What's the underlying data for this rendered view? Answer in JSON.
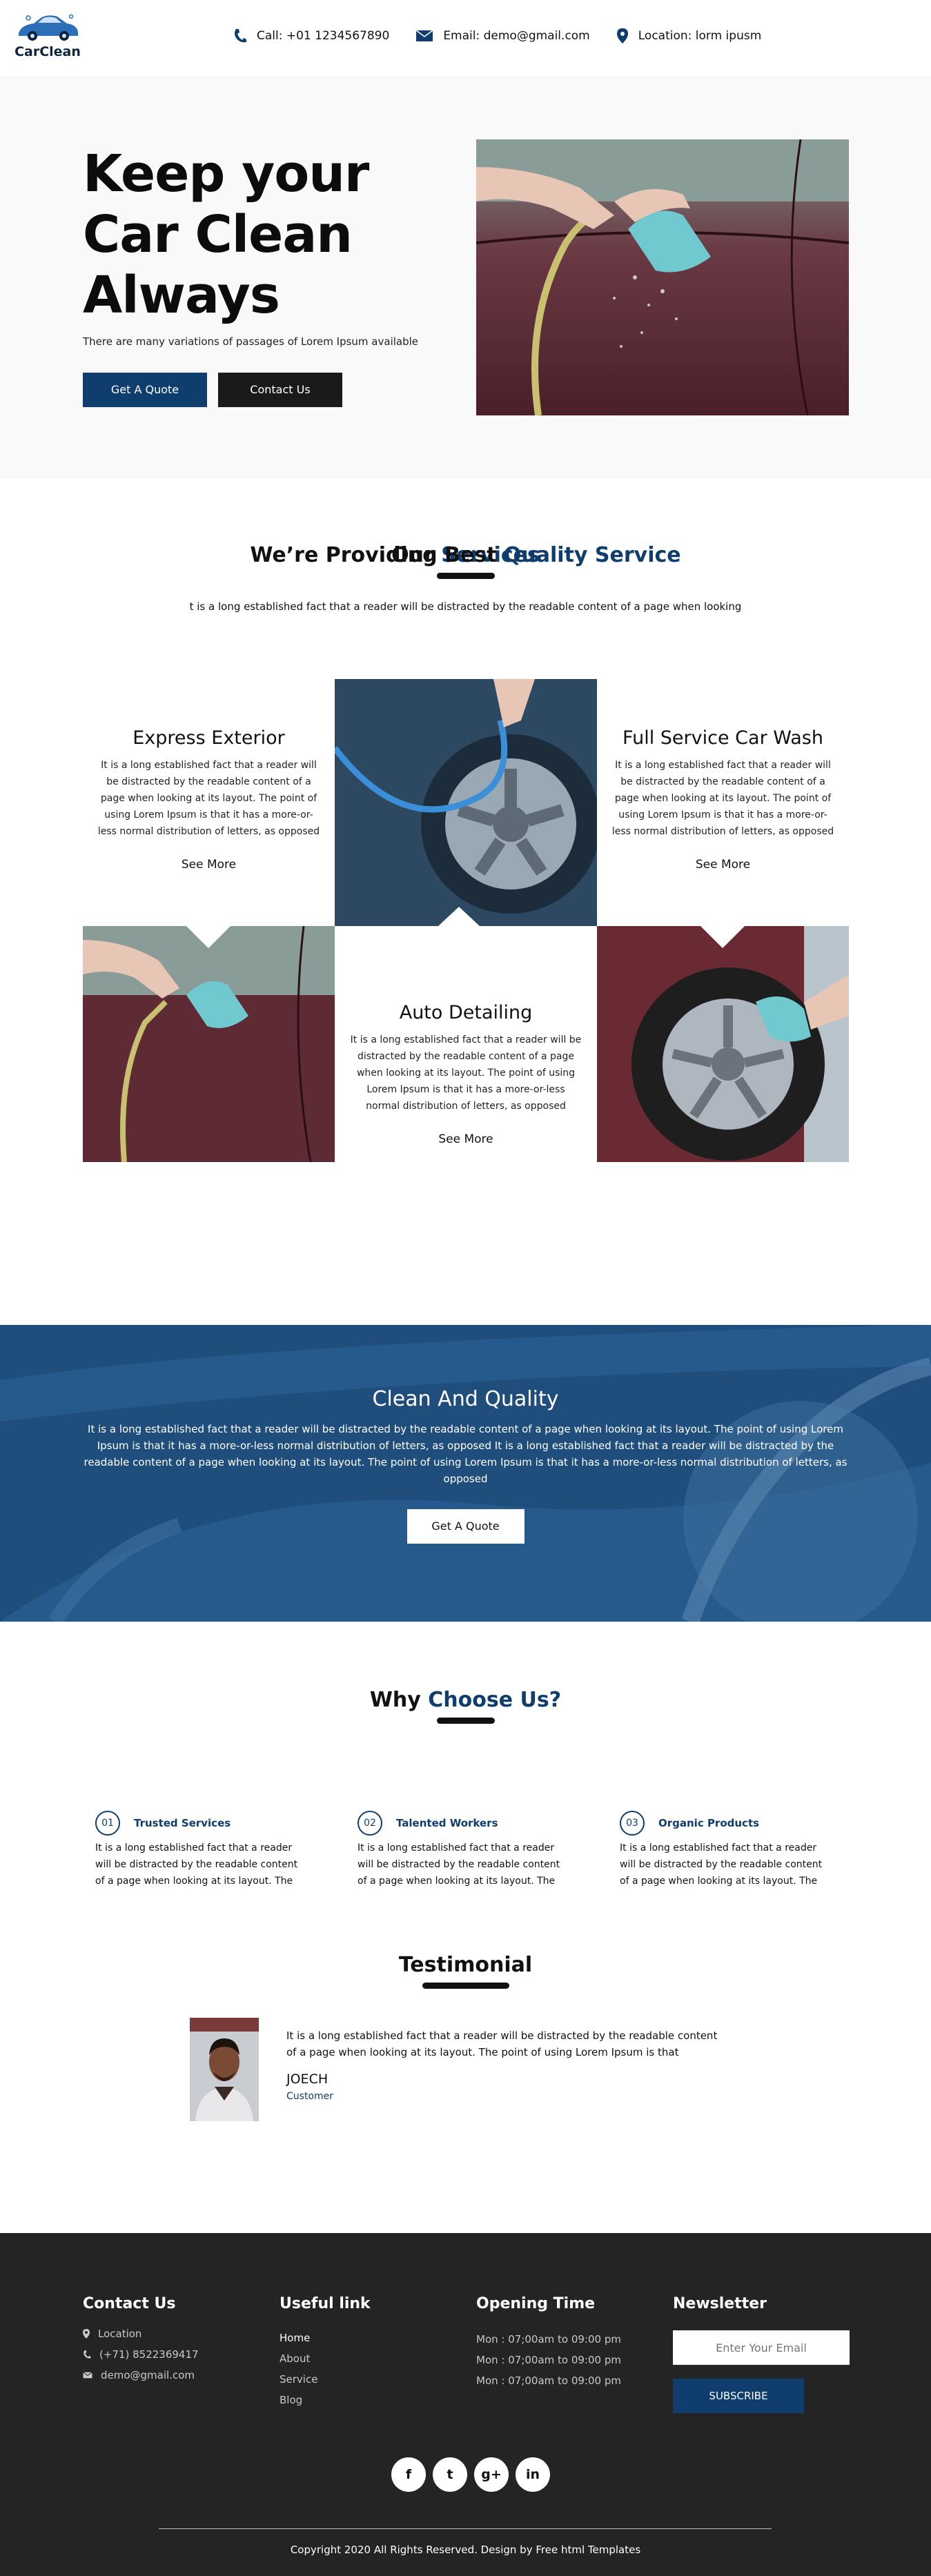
{
  "brand": {
    "name": "CarClean",
    "primary": "#0e3d6e",
    "dark": "#1a1a1a"
  },
  "header": {
    "call": "Call: +01 1234567890",
    "email": "Email: demo@gmail.com",
    "location": "Location: lorm ipusm"
  },
  "hero": {
    "title_line1": "Keep your",
    "title_line2": "Car Clean",
    "title_line3": "Always",
    "subtitle": "There are many variations of passages of Lorem Ipsum available",
    "quote_button": "Get A Quote",
    "contact_button": "Contact Us"
  },
  "services": {
    "title_a": "Our ",
    "title_b": "Services",
    "subtitle": "t is a long established fact that a reader will be distracted by the readable content of a page when looking",
    "items": [
      {
        "title": "Express Exterior",
        "text": "It is a long established fact that a reader will be distracted by the readable content of a page when looking at its layout. The point of using Lorem Ipsum is that it has a more-or-less normal distribution of letters, as opposed",
        "more": "See More"
      },
      {
        "title": "Full Service Car Wash",
        "text": "It is a long established fact that a reader will be distracted by the readable content of a page when looking at its layout. The point of using Lorem Ipsum is that it has a more-or-less normal distribution of letters, as opposed",
        "more": "See More"
      },
      {
        "title": "Auto Detailing",
        "text": "It is a long established fact that a reader will be distracted by the readable content of a page when looking at its layout. The point of using Lorem Ipsum is that it has a more-or-less normal distribution of letters, as opposed",
        "more": "See More"
      }
    ]
  },
  "providing": {
    "title_a": "We’re Providing Best ",
    "title_b": "Quality Service"
  },
  "band": {
    "title": "Clean And Quality",
    "text": "It is a long established fact that a reader will be distracted by the readable content of a page when looking at its layout. The point of using Lorem Ipsum is that it has a more-or-less normal distribution of letters, as opposed It is a long established fact that a reader will be distracted by the readable content of a page when looking at its layout. The point of using Lorem Ipsum is that it has a more-or-less normal distribution of letters, as opposed",
    "button": "Get A Quote"
  },
  "why": {
    "title_a": "Why ",
    "title_b": "Choose Us?",
    "features": [
      {
        "num": "01",
        "title": "Trusted Services",
        "text": "It is a long established fact that a reader will be distracted by the readable content of a page when looking at its layout. The"
      },
      {
        "num": "02",
        "title": "Talented Workers",
        "text": "It is a long established fact that a reader will be distracted by the readable content of a page when looking at its layout. The"
      },
      {
        "num": "03",
        "title": "Organic Products",
        "text": "It is a long established fact that a reader will be distracted by the readable content of a page when looking at its layout. The"
      }
    ]
  },
  "testimonial": {
    "title": "Testimonial",
    "quote": "It is a long established fact that a reader will be distracted by the readable content of a page when looking at its layout. The point of using Lorem Ipsum is that",
    "name": "JOECH",
    "role": "Customer"
  },
  "footer": {
    "contact_title": "Contact Us",
    "location": "Location",
    "phone": "(+71) 8522369417",
    "email": "demo@gmail.com",
    "links_title": "Useful link",
    "links": [
      "Home",
      "About",
      "Service",
      "Blog"
    ],
    "opening_title": "Opening Time",
    "hours": [
      "Mon : 07;00am to 09:00 pm",
      "Mon : 07;00am to 09:00 pm",
      "Mon : 07;00am to 09:00 pm"
    ],
    "newsletter_title": "Newsletter",
    "email_placeholder": "Enter Your Email",
    "subscribe": "SUBSCRIBE",
    "social": {
      "facebook": "f",
      "twitter": "t",
      "google": "g+",
      "linkedin": "in"
    },
    "copyright": "Copyright 2020 All Rights Reserved. Design by Free html Templates"
  }
}
